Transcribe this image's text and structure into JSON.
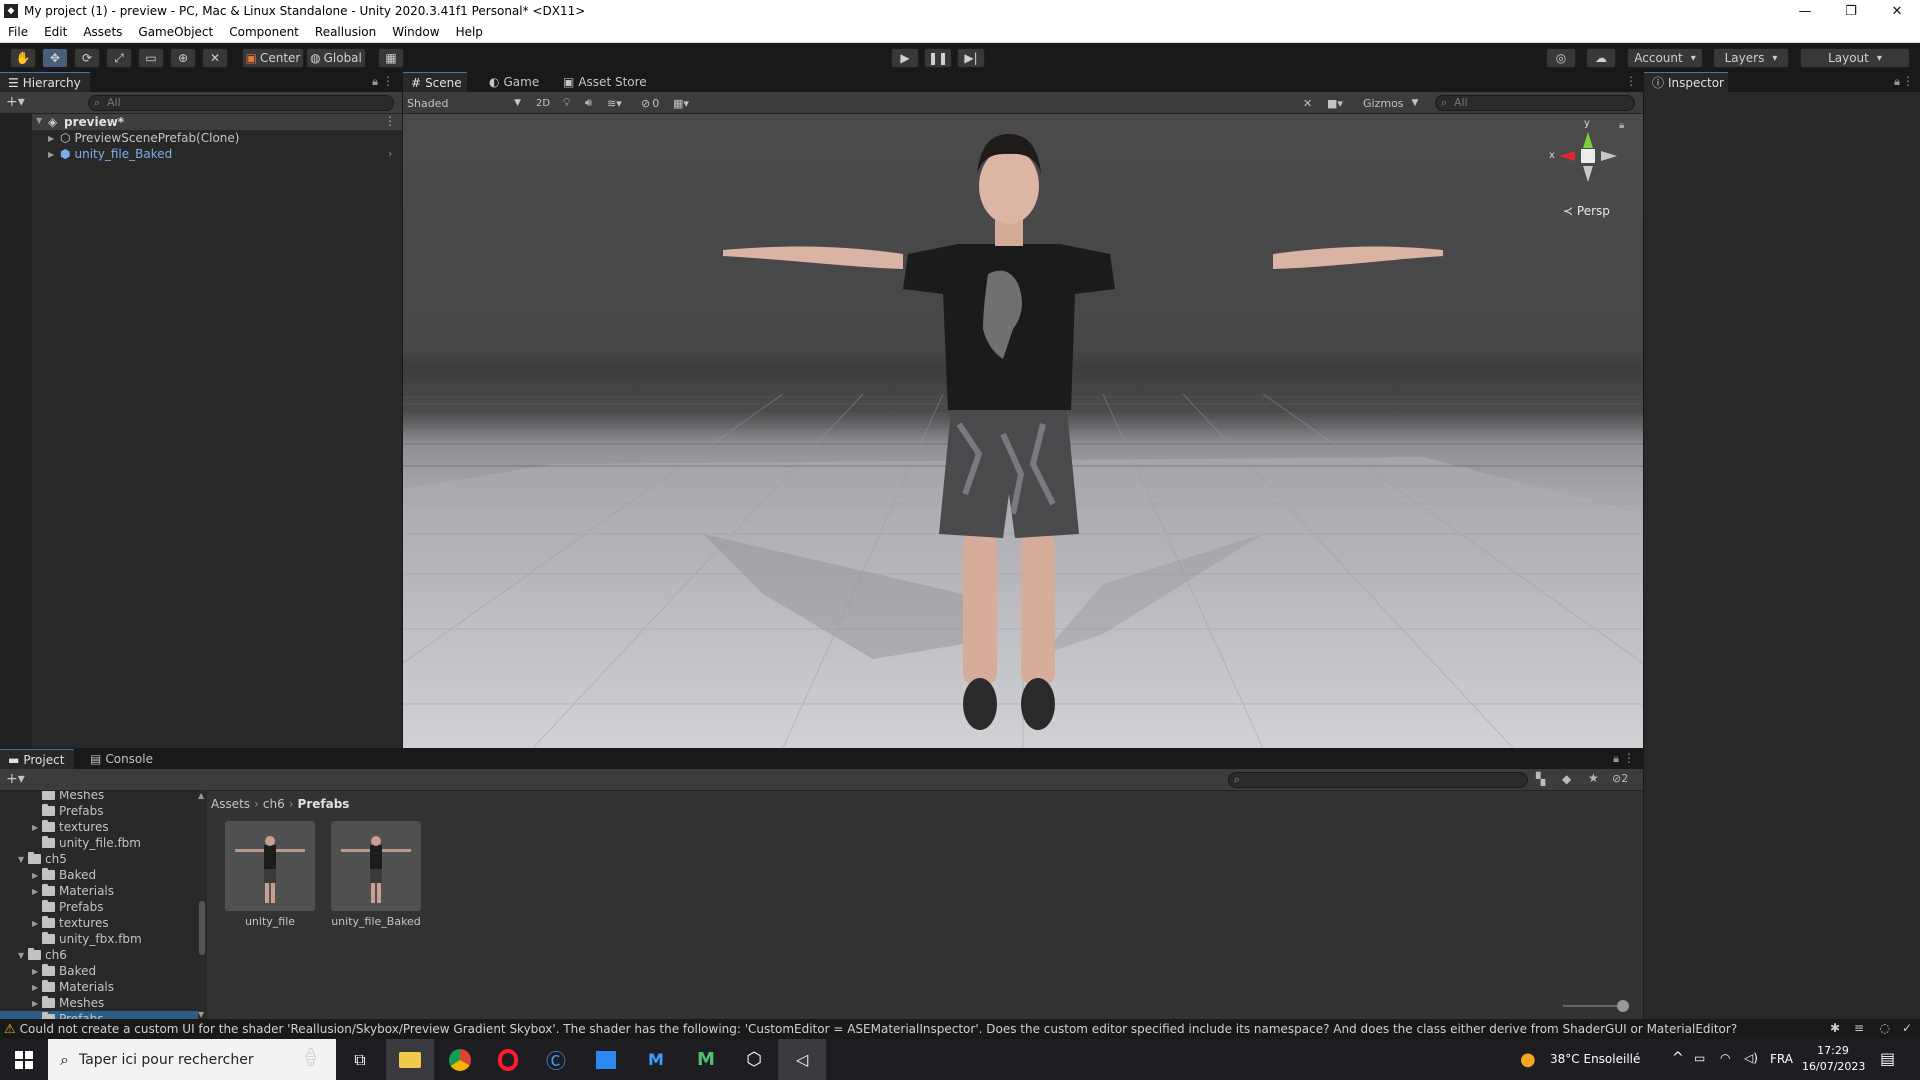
{
  "window": {
    "title": "My project (1) - preview - PC, Mac & Linux Standalone - Unity 2020.3.41f1 Personal* <DX11>",
    "controls": [
      "—",
      "❐",
      "✕"
    ]
  },
  "menu": [
    "File",
    "Edit",
    "Assets",
    "GameObject",
    "Component",
    "Reallusion",
    "Window",
    "Help"
  ],
  "toolbar": {
    "pivot": "Center",
    "space": "Global",
    "account": "Account",
    "layers": "Layers",
    "layout": "Layout"
  },
  "hierarchy": {
    "tab": "Hierarchy",
    "search_placeholder": "All",
    "scene": "preview*",
    "items": [
      "PreviewScenePrefab(Clone)",
      "unity_file_Baked"
    ]
  },
  "scene": {
    "tabs": [
      "Scene",
      "Game",
      "Asset Store"
    ],
    "shading": "Shaded",
    "mode_2d": "2D",
    "hidden_count": "0",
    "gizmos": "Gizmos",
    "search_placeholder": "All",
    "projection": "Persp",
    "axis_y": "y",
    "axis_x": "x"
  },
  "inspector": {
    "tab": "Inspector"
  },
  "project": {
    "tabs": [
      "Project",
      "Console"
    ],
    "hidden_count": "2",
    "breadcrumb": [
      "Assets",
      "ch6",
      "Prefabs"
    ],
    "tree": [
      {
        "label": "Meshes",
        "indent": 2,
        "arrow": "",
        "folder": true
      },
      {
        "label": "Prefabs",
        "indent": 2,
        "arrow": "",
        "folder": true
      },
      {
        "label": "textures",
        "indent": 2,
        "arrow": "▶",
        "folder": true
      },
      {
        "label": "unity_file.fbm",
        "indent": 2,
        "arrow": "",
        "folder": true
      },
      {
        "label": "ch5",
        "indent": 1,
        "arrow": "▼",
        "folder": true
      },
      {
        "label": "Baked",
        "indent": 2,
        "arrow": "▶",
        "folder": true
      },
      {
        "label": "Materials",
        "indent": 2,
        "arrow": "▶",
        "folder": true
      },
      {
        "label": "Prefabs",
        "indent": 2,
        "arrow": "",
        "folder": true
      },
      {
        "label": "textures",
        "indent": 2,
        "arrow": "▶",
        "folder": true
      },
      {
        "label": "unity_fbx.fbm",
        "indent": 2,
        "arrow": "",
        "folder": true
      },
      {
        "label": "ch6",
        "indent": 1,
        "arrow": "▼",
        "folder": true
      },
      {
        "label": "Baked",
        "indent": 2,
        "arrow": "▶",
        "folder": true
      },
      {
        "label": "Materials",
        "indent": 2,
        "arrow": "▶",
        "folder": true
      },
      {
        "label": "Meshes",
        "indent": 2,
        "arrow": "▶",
        "folder": true
      },
      {
        "label": "Prefabs",
        "indent": 2,
        "arrow": "",
        "folder": true,
        "selected": true
      }
    ],
    "assets": [
      "unity_file",
      "unity_file_Baked"
    ]
  },
  "status": {
    "message": "Could not create a custom UI for the shader 'Reallusion/Skybox/Preview Gradient Skybox'. The shader has the following: 'CustomEditor = ASEMaterialInspector'. Does the custom editor specified include its namespace? And does the class either derive from ShaderGUI or MaterialEditor?"
  },
  "taskbar": {
    "search_placeholder": "Taper ici pour rechercher",
    "weather_temp": "38°C",
    "weather_desc": "Ensoleillé",
    "language": "FRA",
    "time": "17:29",
    "date": "16/07/2023"
  },
  "colors": {
    "accent": "#3a79bb",
    "selection": "#2c5d87",
    "warning": "#e8b230",
    "prefab_blue": "#7baee8"
  }
}
